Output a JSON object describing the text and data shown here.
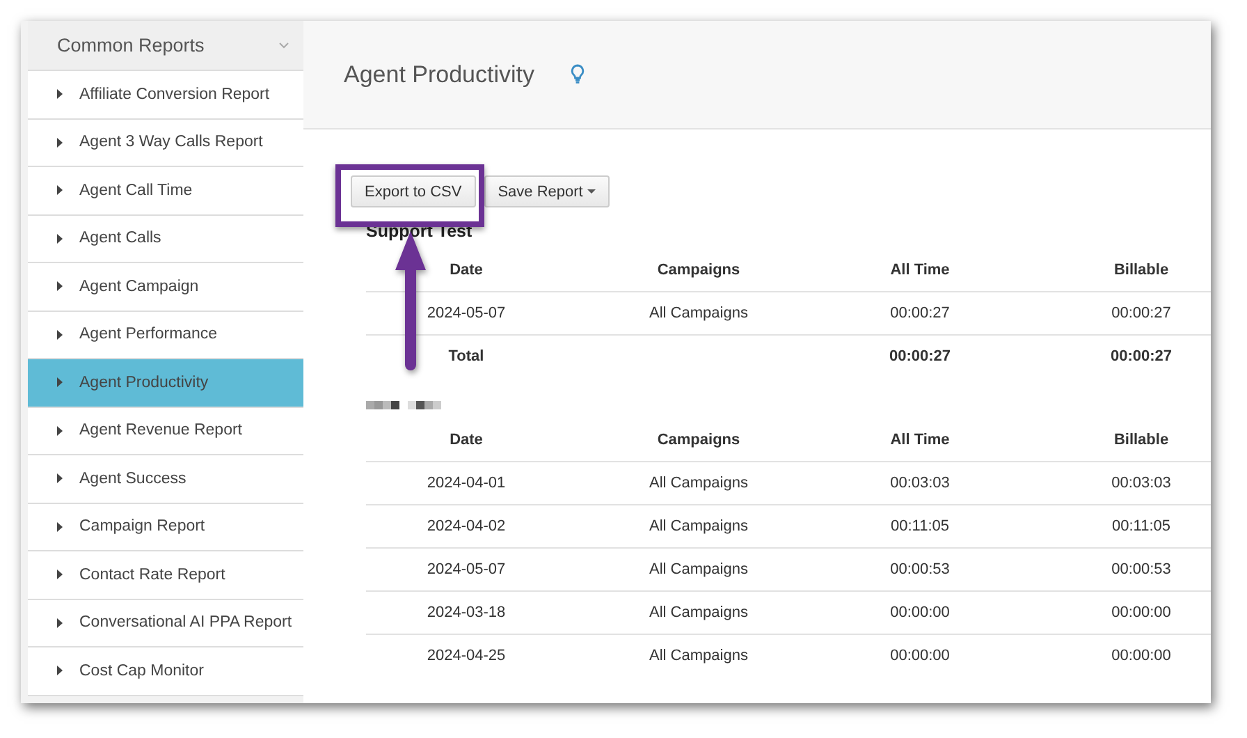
{
  "sidebar": {
    "title": "Common Reports",
    "items": [
      {
        "label": "Affiliate Conversion Report",
        "selected": false
      },
      {
        "label": "Agent 3 Way Calls Report",
        "selected": false
      },
      {
        "label": "Agent Call Time",
        "selected": false
      },
      {
        "label": "Agent Calls",
        "selected": false
      },
      {
        "label": "Agent Campaign",
        "selected": false
      },
      {
        "label": "Agent Performance",
        "selected": false
      },
      {
        "label": "Agent Productivity",
        "selected": true
      },
      {
        "label": "Agent Revenue Report",
        "selected": false
      },
      {
        "label": "Agent Success",
        "selected": false
      },
      {
        "label": "Campaign Report",
        "selected": false
      },
      {
        "label": "Contact Rate Report",
        "selected": false
      },
      {
        "label": "Conversational AI PPA Report",
        "selected": false
      },
      {
        "label": "Cost Cap Monitor",
        "selected": false
      }
    ]
  },
  "page": {
    "title": "Agent Productivity"
  },
  "toolbar": {
    "buttons": [
      {
        "label": "Export to CSV",
        "kind": "button"
      },
      {
        "label": "Save Report",
        "kind": "dropdown"
      }
    ]
  },
  "reports": [
    {
      "title": "Support Test",
      "columns": [
        "Date",
        "Campaigns",
        "All Time",
        "Billable"
      ],
      "rows": [
        [
          "2024-05-07",
          "All Campaigns",
          "00:00:27",
          "00:00:27"
        ]
      ],
      "total": {
        "label": "Total",
        "values": [
          "00:00:27",
          "00:00:27"
        ]
      }
    },
    {
      "redacted_title": true,
      "columns": [
        "Date",
        "Campaigns",
        "All Time",
        "Billable"
      ],
      "rows": [
        [
          "2024-04-01",
          "All Campaigns",
          "00:03:03",
          "00:03:03"
        ],
        [
          "2024-04-02",
          "All Campaigns",
          "00:11:05",
          "00:11:05"
        ],
        [
          "2024-05-07",
          "All Campaigns",
          "00:00:53",
          "00:00:53"
        ],
        [
          "2024-03-18",
          "All Campaigns",
          "00:00:00",
          "00:00:00"
        ],
        [
          "2024-04-25",
          "All Campaigns",
          "00:00:00",
          "00:00:00"
        ]
      ]
    }
  ]
}
